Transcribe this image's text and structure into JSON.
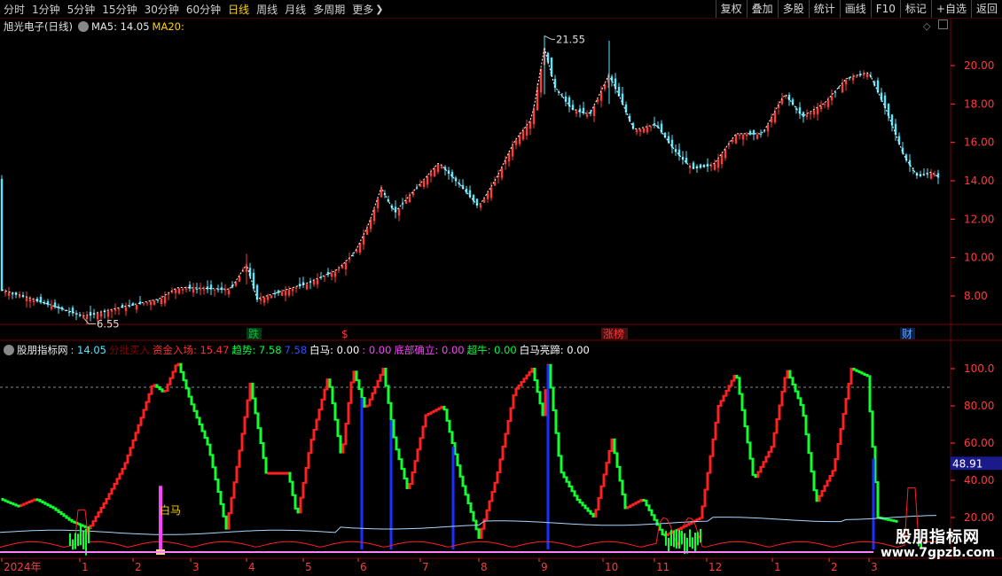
{
  "toolbar": {
    "periods": [
      "分时",
      "1分钟",
      "5分钟",
      "15分钟",
      "30分钟",
      "60分钟",
      "日线",
      "周线",
      "月线",
      "多周期",
      "更多"
    ],
    "active_period": "日线",
    "right_buttons": [
      "复权",
      "叠加",
      "多股",
      "统计",
      "画线",
      "F10",
      "标记",
      "+自选",
      "返回"
    ]
  },
  "main_chart": {
    "stock_title": "旭光电子(日线)",
    "ma5_label": "MA5: 14.05",
    "ma20_label": "MA20:",
    "high_label": "21.55",
    "low_label": "6.55",
    "y_ticks": [
      "20.00",
      "18.00",
      "16.00",
      "14.00",
      "12.00",
      "10.00",
      "8.00"
    ],
    "event_labels": [
      "跌",
      "$",
      "涨榜",
      "财"
    ],
    "colors": {
      "up": "#ff3b3b",
      "down": "#54e8ff",
      "ma": "#ffffff",
      "grid": "#500000"
    }
  },
  "indicator": {
    "name": "股朋指标网",
    "values": [
      {
        "label": ": 14.05",
        "color": "#54e8ff"
      },
      {
        "label": "分批买入",
        "color": "#8b0000"
      },
      {
        "label": "资金入场: 15.47",
        "color": "#ff3030"
      },
      {
        "label": "趋势: 7.58",
        "color": "#00ff40"
      },
      {
        "label": "7.58",
        "color": "#3050ff"
      },
      {
        "label": "白马: 0.00",
        "color": "#ffffff"
      },
      {
        "label": ": 0.00",
        "color": "#ff40ff"
      },
      {
        "label": "底部确立: 0.00",
        "color": "#ff40ff"
      },
      {
        "label": "超牛: 0.00",
        "color": "#00ff40"
      },
      {
        "label": "白马亮蹄: 0.00",
        "color": "#ffffff"
      }
    ],
    "y_ticks": [
      "100.0",
      "80.00",
      "60.00",
      "40.00",
      "20.00"
    ],
    "current_value": "48.91",
    "annotation": "白马"
  },
  "x_axis": {
    "labels": [
      "2024年",
      "1",
      "2",
      "3",
      "4",
      "5",
      "6",
      "7",
      "8",
      "9",
      "10",
      "11",
      "12",
      "1",
      "2",
      "3"
    ]
  },
  "watermark": {
    "line1": "股朋指标网",
    "line2": "www.7gpzb.com"
  }
}
